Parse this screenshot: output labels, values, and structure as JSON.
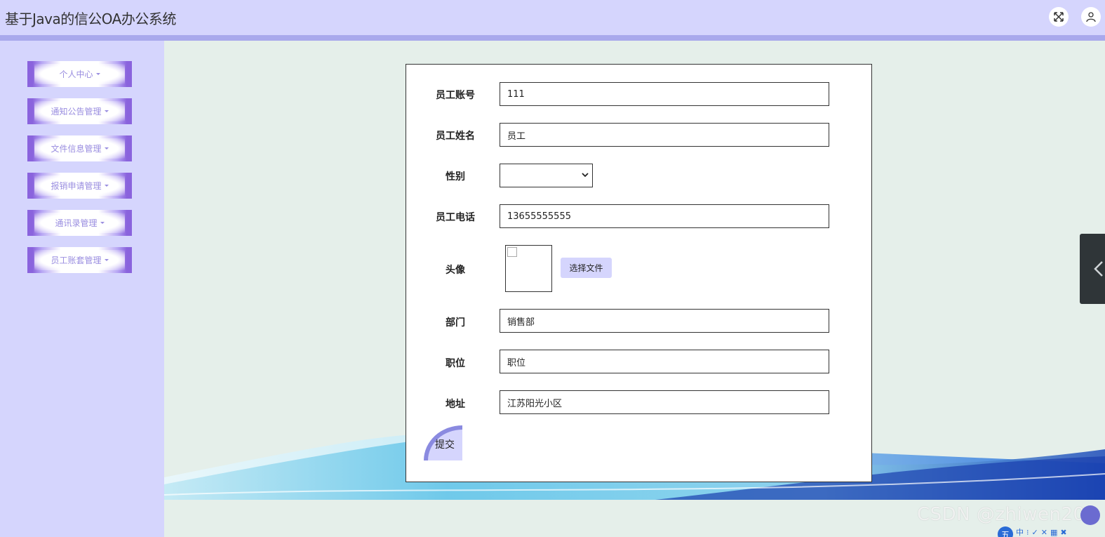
{
  "app": {
    "title": "基于Java的信公OA办公系统"
  },
  "header": {
    "fullscreen_icon": "expand-icon",
    "user_icon": "user-icon"
  },
  "sidebar": {
    "items": [
      {
        "label": "个人中心"
      },
      {
        "label": "通知公告管理"
      },
      {
        "label": "文件信息管理"
      },
      {
        "label": "报销申请管理"
      },
      {
        "label": "通讯录管理"
      },
      {
        "label": "员工账套管理"
      }
    ]
  },
  "form": {
    "account": {
      "label": "员工账号",
      "value": "111"
    },
    "name": {
      "label": "员工姓名",
      "value": "员工"
    },
    "gender": {
      "label": "性别",
      "value": ""
    },
    "phone": {
      "label": "员工电话",
      "value": "13655555555"
    },
    "avatar": {
      "label": "头像",
      "button": "选择文件"
    },
    "department": {
      "label": "部门",
      "value": "销售部"
    },
    "position": {
      "label": "职位",
      "value": "职位"
    },
    "address": {
      "label": "地址",
      "value": "江苏阳光小区"
    },
    "submit": "提交"
  },
  "watermark": "CSDN @zhiwen205",
  "tray": {
    "logo": "五",
    "items": [
      "中",
      "⁝",
      "✓",
      "✕",
      "▦",
      "✖"
    ]
  },
  "colors": {
    "header": "#d5d5fd",
    "accent": "#8a63dd",
    "background": "#e5efea"
  }
}
